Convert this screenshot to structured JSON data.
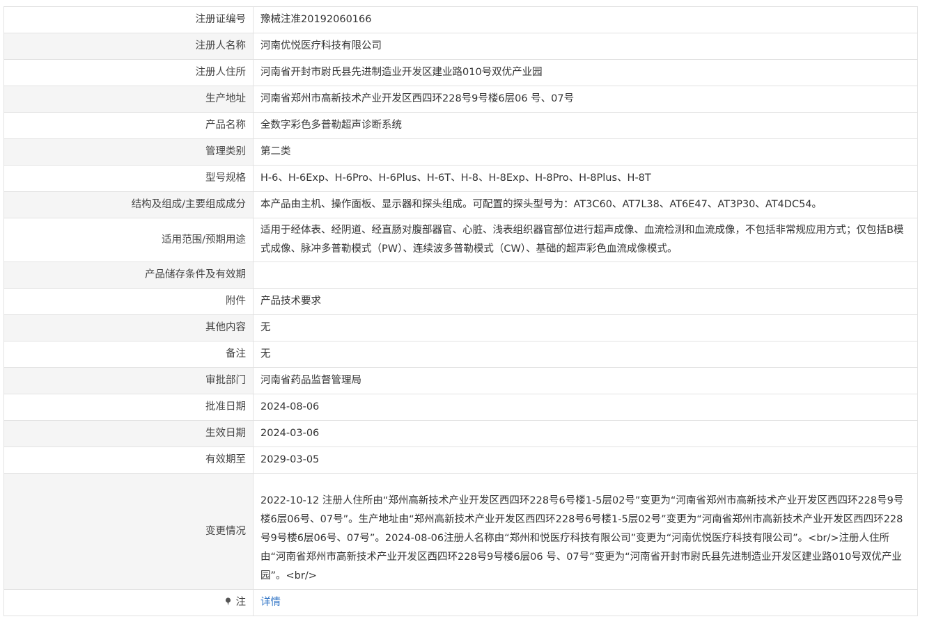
{
  "rows": [
    {
      "label": "注册证编号",
      "value": "豫械注准20192060166"
    },
    {
      "label": "注册人名称",
      "value": "河南优悦医疗科技有限公司"
    },
    {
      "label": "注册人住所",
      "value": "河南省开封市尉氏县先进制造业开发区建业路010号双优产业园"
    },
    {
      "label": "生产地址",
      "value": "河南省郑州市高新技术产业开发区西四环228号9号楼6层06 号、07号"
    },
    {
      "label": "产品名称",
      "value": "全数字彩色多普勒超声诊断系统"
    },
    {
      "label": "管理类别",
      "value": "第二类"
    },
    {
      "label": "型号规格",
      "value": "H-6、H-6Exp、H-6Pro、H-6Plus、H-6T、H-8、H-8Exp、H-8Pro、H-8Plus、H-8T"
    },
    {
      "label": "结构及组成/主要组成成分",
      "value": "本产品由主机、操作面板、显示器和探头组成。可配置的探头型号为：AT3C60、AT7L38、AT6E47、AT3P30、AT4DC54。"
    },
    {
      "label": "适用范围/预期用途",
      "value": "适用于经体表、经阴道、经直肠对腹部器官、心脏、浅表组织器官部位进行超声成像、血流检测和血流成像，不包括非常规应用方式；仅包括B模式成像、脉冲多普勒模式（PW）、连续波多普勒模式（CW）、基础的超声彩色血流成像模式。"
    },
    {
      "label": "产品储存条件及有效期",
      "value": ""
    },
    {
      "label": "附件",
      "value": "产品技术要求"
    },
    {
      "label": "其他内容",
      "value": "无"
    },
    {
      "label": "备注",
      "value": "无"
    },
    {
      "label": "审批部门",
      "value": "河南省药品监督管理局"
    },
    {
      "label": "批准日期",
      "value": "2024-08-06"
    },
    {
      "label": "生效日期",
      "value": "2024-03-06"
    },
    {
      "label": "有效期至",
      "value": "2029-03-05"
    },
    {
      "label": "变更情况",
      "value": "2022-10-12 注册人住所由“郑州高新技术产业开发区西四环228号6号楼1-5层02号”变更为“河南省郑州市高新技术产业开发区西四环228号9号楼6层06号、07号”。生产地址由“郑州高新技术产业开发区西四环228号6号楼1-5层02号”变更为“河南省郑州市高新技术产业开发区西四环228号9号楼6层06号、07号”。2024-08-06注册人名称由“郑州和悦医疗科技有限公司”变更为“河南优悦医疗科技有限公司”。<br/>注册人住所由“河南省郑州市高新技术产业开发区西四环228号9号楼6层06 号、07号”变更为“河南省开封市尉氏县先进制造业开发区建业路010号双优产业园”。<br/>"
    }
  ],
  "note": {
    "icon": "pin-icon",
    "label": "注",
    "link_text": "详情",
    "link_color": "#3779c8"
  }
}
